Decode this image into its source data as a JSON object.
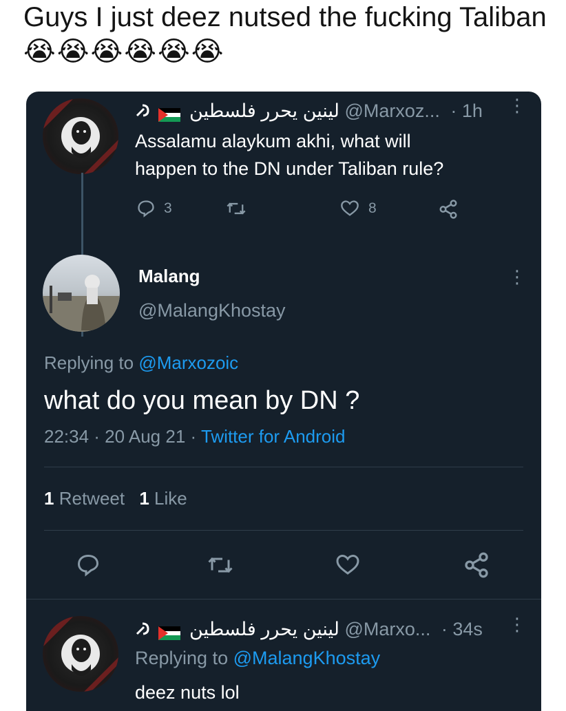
{
  "caption": {
    "text": "Guys I just deez nutsed the fucking Taliban",
    "emoji": "😭😭😭😭😭😭"
  },
  "tweet1": {
    "display_name": "لينين يحرر فلسطين",
    "handle": "@Marxoz...",
    "time": "· 1h",
    "text_line1": "Assalamu alaykum akhi, what will",
    "text_line2": "happen to the DN under Taliban rule?",
    "reply_count": "3",
    "like_count": "8"
  },
  "main_tweet": {
    "display_name": "Malang",
    "handle": "@MalangKhostay",
    "replying_label": "Replying to",
    "replying_to": "@Marxozoic",
    "text": "what do you mean by DN ?",
    "time": "22:34 · 20 Aug 21 ·",
    "source": "Twitter for Android",
    "retweet_count": "1",
    "retweet_label": "Retweet",
    "like_count": "1",
    "like_label": "Like"
  },
  "reply": {
    "display_name": "لينين يحرر فلسطين",
    "handle": "@Marxo...",
    "time": "· 34s",
    "replying_label": "Replying to",
    "replying_to": "@MalangKhostay",
    "text": "deez nuts lol"
  },
  "colors": {
    "card_bg": "#15202b",
    "link": "#1d9bf0",
    "muted": "#8899a6"
  },
  "icons": [
    "reply-icon",
    "retweet-icon",
    "like-icon",
    "share-icon",
    "more-icon",
    "palestine-flag-icon",
    "hammer-sickle-icon"
  ]
}
